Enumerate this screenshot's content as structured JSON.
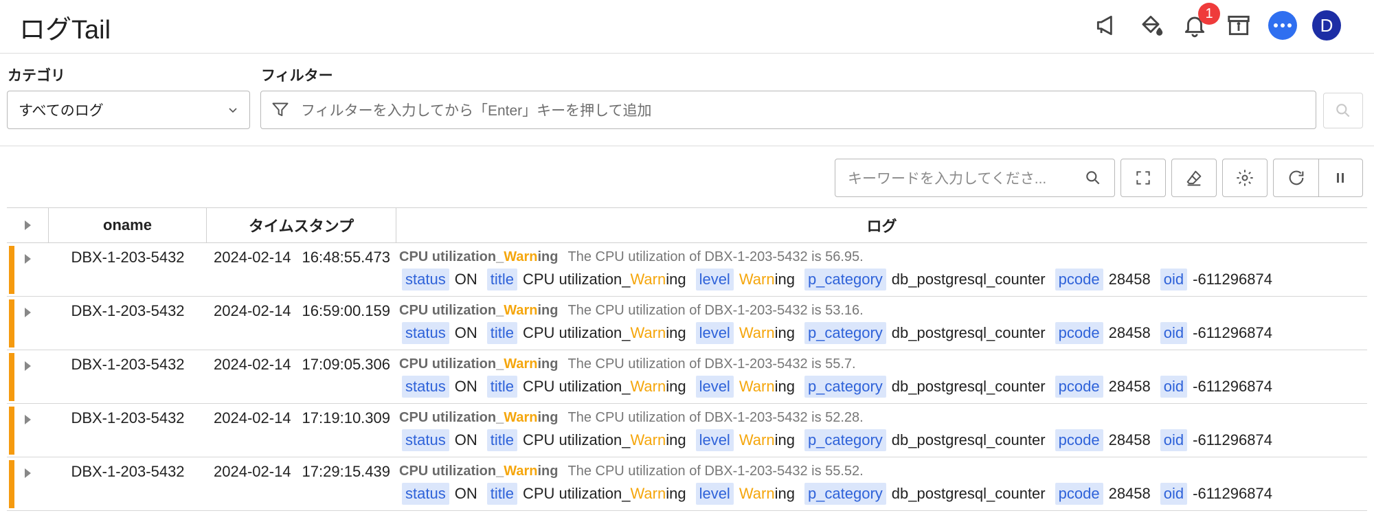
{
  "header": {
    "title": "ログTail",
    "notification_count": "1",
    "avatar_initial": "D"
  },
  "filters": {
    "category_label": "カテゴリ",
    "category_value": "すべてのログ",
    "filter_label": "フィルター",
    "filter_placeholder": "フィルターを入力してから「Enter」キーを押して追加"
  },
  "toolbar": {
    "keyword_placeholder": "キーワードを入力してくださ..."
  },
  "table": {
    "columns": {
      "oname": "oname",
      "timestamp": "タイムスタンプ",
      "log": "ログ"
    },
    "field_labels": {
      "status": "status",
      "title": "title",
      "level": "level",
      "p_category": "p_category",
      "pcode": "pcode",
      "oid": "oid"
    },
    "rows": [
      {
        "oname": "DBX-1-203-5432",
        "date": "2024-02-14",
        "time": "16:48:55.473",
        "title_pre": "CPU utilization_",
        "title_warn": "Warn",
        "title_post": "ing",
        "message": "The CPU utilization of DBX-1-203-5432 is 56.95.",
        "status": "ON",
        "level_warn": "Warn",
        "level_post": "ing",
        "p_category": "db_postgresql_counter",
        "pcode": "28458",
        "oid": "-611296874"
      },
      {
        "oname": "DBX-1-203-5432",
        "date": "2024-02-14",
        "time": "16:59:00.159",
        "title_pre": "CPU utilization_",
        "title_warn": "Warn",
        "title_post": "ing",
        "message": "The CPU utilization of DBX-1-203-5432 is 53.16.",
        "status": "ON",
        "level_warn": "Warn",
        "level_post": "ing",
        "p_category": "db_postgresql_counter",
        "pcode": "28458",
        "oid": "-611296874"
      },
      {
        "oname": "DBX-1-203-5432",
        "date": "2024-02-14",
        "time": "17:09:05.306",
        "title_pre": "CPU utilization_",
        "title_warn": "Warn",
        "title_post": "ing",
        "message": "The CPU utilization of DBX-1-203-5432 is 55.7.",
        "status": "ON",
        "level_warn": "Warn",
        "level_post": "ing",
        "p_category": "db_postgresql_counter",
        "pcode": "28458",
        "oid": "-611296874"
      },
      {
        "oname": "DBX-1-203-5432",
        "date": "2024-02-14",
        "time": "17:19:10.309",
        "title_pre": "CPU utilization_",
        "title_warn": "Warn",
        "title_post": "ing",
        "message": "The CPU utilization of DBX-1-203-5432 is 52.28.",
        "status": "ON",
        "level_warn": "Warn",
        "level_post": "ing",
        "p_category": "db_postgresql_counter",
        "pcode": "28458",
        "oid": "-611296874"
      },
      {
        "oname": "DBX-1-203-5432",
        "date": "2024-02-14",
        "time": "17:29:15.439",
        "title_pre": "CPU utilization_",
        "title_warn": "Warn",
        "title_post": "ing",
        "message": "The CPU utilization of DBX-1-203-5432 is 55.52.",
        "status": "ON",
        "level_warn": "Warn",
        "level_post": "ing",
        "p_category": "db_postgresql_counter",
        "pcode": "28458",
        "oid": "-611296874"
      }
    ]
  },
  "colors": {
    "accent": "#2f6ff0",
    "warning": "#f5a60c",
    "row_bar": "#f59a0f",
    "tag_bg": "#dbe6fb",
    "tag_text": "#2e62d9",
    "badge": "#ef3b3b",
    "avatar": "#1d2ea5"
  },
  "icons": [
    "megaphone-icon",
    "paint-bucket-icon",
    "bell-icon",
    "archive-icon",
    "chat-icon",
    "chevron-down-icon",
    "filter-icon",
    "search-icon",
    "fullscreen-icon",
    "eraser-icon",
    "gear-icon",
    "refresh-icon",
    "pause-icon",
    "expand-triangle-icon"
  ]
}
